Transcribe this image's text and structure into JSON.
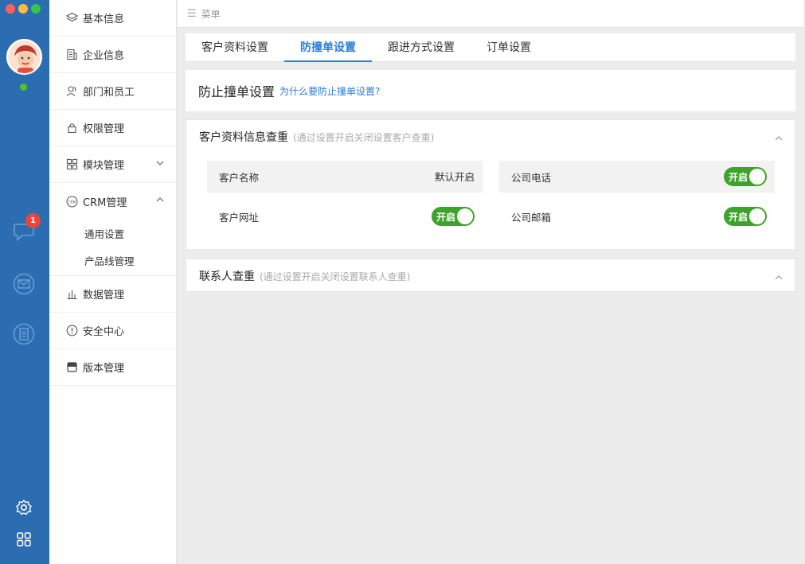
{
  "rail": {
    "notification_count": "1",
    "icons": [
      "chat-icon",
      "mail-icon",
      "document-icon",
      "settings-icon",
      "apps-icon"
    ]
  },
  "sidebar": {
    "items": [
      {
        "label": "基本信息",
        "icon": "layers-icon"
      },
      {
        "label": "企业信息",
        "icon": "building-icon"
      },
      {
        "label": "部门和员工",
        "icon": "users-icon"
      },
      {
        "label": "权限管理",
        "icon": "lock-icon"
      },
      {
        "label": "模块管理",
        "icon": "modules-icon"
      },
      {
        "label": "CRM管理",
        "icon": "crm-icon"
      },
      {
        "label": "数据管理",
        "icon": "bar-chart-icon"
      },
      {
        "label": "安全中心",
        "icon": "alert-icon"
      },
      {
        "label": "版本管理",
        "icon": "version-icon"
      }
    ],
    "crm_sub": [
      "通用设置",
      "产品线管理"
    ]
  },
  "topbar": {
    "menu_label": "菜单"
  },
  "tabs": [
    {
      "label": "客户资料设置",
      "active": false
    },
    {
      "label": "防撞单设置",
      "active": true
    },
    {
      "label": "跟进方式设置",
      "active": false
    },
    {
      "label": "订单设置",
      "active": false
    }
  ],
  "heading": {
    "title": "防止撞单设置",
    "link": "为什么要防止撞单设置?"
  },
  "panel_customer": {
    "title": "客户资料信息查重",
    "subtitle": "(通过设置开启关闭设置客户查重)",
    "fields": [
      {
        "label": "客户名称",
        "value": "默认开启"
      },
      {
        "label": "公司电话",
        "toggle": "开启"
      },
      {
        "label": "客户网址",
        "toggle": "开启"
      },
      {
        "label": "公司邮箱",
        "toggle": "开启"
      }
    ]
  },
  "panel_contact": {
    "title": "联系人查重",
    "subtitle": "(通过设置开启关闭设置联系人查重)"
  },
  "colors": {
    "rail": "#2c6db1",
    "accent": "#2b7ed6",
    "toggle_on": "#3da32a",
    "badge": "#e8453c"
  }
}
